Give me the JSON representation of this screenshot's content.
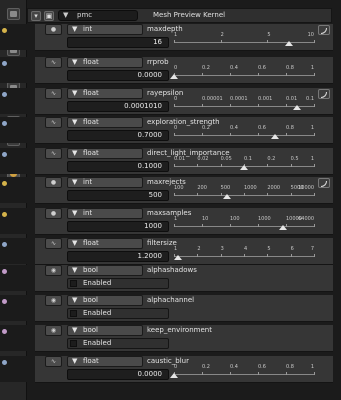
{
  "toolbar": {
    "icons": [
      "render-icon",
      "scene-icon",
      "world-icon",
      "object-icon",
      "modifier-icon",
      "material-icon",
      "texture-icon",
      "particle-icon",
      "physics-icon",
      "settings-icon"
    ]
  },
  "panel": {
    "selected": "pmc",
    "title": "Mesh Preview Kernel"
  },
  "colors": {
    "int_dot": "#d5b34a",
    "float_dot": "#8fa6c8",
    "bool_dot": "#c19bc8"
  },
  "params": [
    {
      "type": "int",
      "name": "maxdepth",
      "value": "16",
      "ticks": [
        "1",
        "2",
        "5",
        "10"
      ]
    },
    {
      "type": "float",
      "name": "rrprob",
      "value": "0.0000",
      "ticks": [
        "0",
        "0.2",
        "0.4",
        "0.6",
        "0.8",
        "1"
      ]
    },
    {
      "type": "float",
      "name": "rayepsilon",
      "value": "0.0001010",
      "ticks": [
        "0",
        "0.00001",
        "0.0001",
        "0.001",
        "0.01",
        "0.1"
      ]
    },
    {
      "type": "float",
      "name": "exploration_strength",
      "value": "0.7000",
      "ticks": [
        "0",
        "0.2",
        "0.4",
        "0.6",
        "0.8",
        "1"
      ]
    },
    {
      "type": "float",
      "name": "direct_light_importance",
      "value": "0.1000",
      "ticks": [
        "0.01",
        "0.02",
        "0.05",
        "0.1",
        "0.2",
        "0.5",
        "1"
      ]
    },
    {
      "type": "int",
      "name": "maxrejects",
      "value": "500",
      "ticks": [
        "100",
        "200",
        "500",
        "1000",
        "2000",
        "5000",
        "10000"
      ]
    },
    {
      "type": "int",
      "name": "maxsamples",
      "value": "1000",
      "ticks": [
        "1",
        "10",
        "100",
        "1000",
        "10000",
        "64000"
      ]
    },
    {
      "type": "float",
      "name": "filtersize",
      "value": "1.2000",
      "ticks": [
        "1",
        "2",
        "3",
        "4",
        "5",
        "6",
        "7"
      ]
    },
    {
      "type": "bool",
      "name": "alphashadows",
      "value": "Enabled"
    },
    {
      "type": "bool",
      "name": "alphachannel",
      "value": "Enabled"
    },
    {
      "type": "bool",
      "name": "keep_environment",
      "value": "Enabled"
    },
    {
      "type": "float",
      "name": "caustic_blur",
      "value": "0.0000",
      "ticks": [
        "0",
        "0.2",
        "0.4",
        "0.6",
        "0.8",
        "1"
      ]
    }
  ]
}
